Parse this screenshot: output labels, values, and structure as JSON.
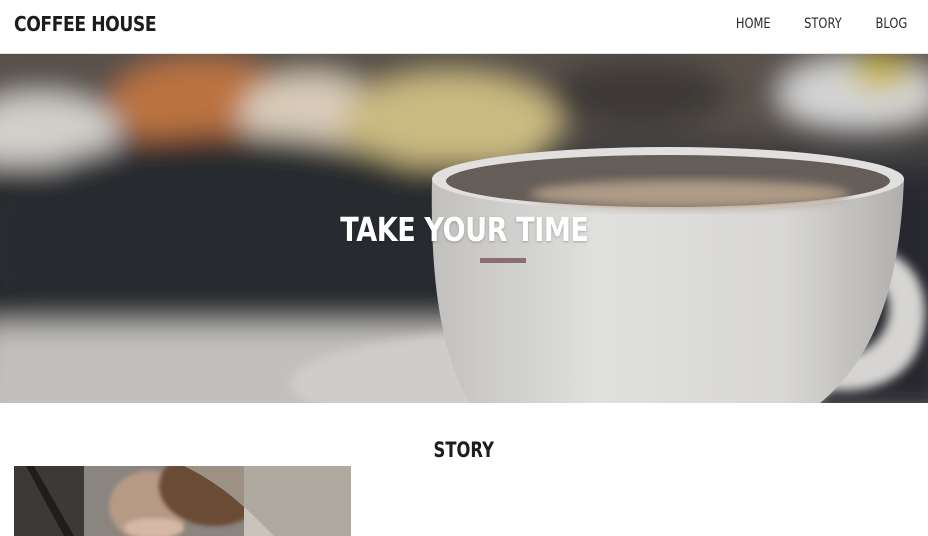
{
  "header": {
    "brand": "COFFEE HOUSE",
    "nav": [
      "HOME",
      "STORY",
      "BLOG"
    ]
  },
  "hero": {
    "title": "TAKE YOUR TIME",
    "accent_color": "#8a6f70"
  },
  "story": {
    "heading": "STORY"
  }
}
